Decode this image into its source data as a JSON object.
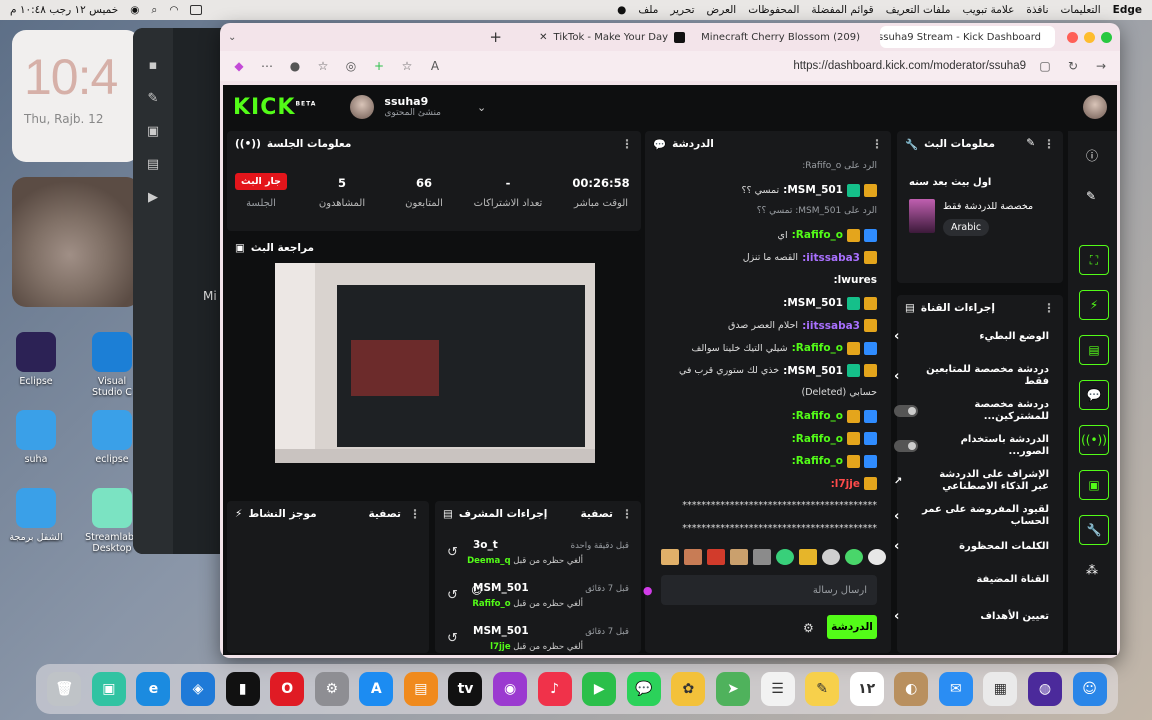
{
  "menubar": {
    "app": "Edge",
    "items": [
      "ملف",
      "تحرير",
      "العرض",
      "المحفوظات",
      "قوائم المفضلة",
      "ملفات التعريف",
      "علامة تبويب",
      "نافذة",
      "التعليمات"
    ],
    "clock": "خميس ١٢ رجب ١٠:٤٨ م"
  },
  "widgets": {
    "time": "10:4",
    "date": "Thu, Rajb. 12"
  },
  "desktop_icons": [
    {
      "label": "Eclipse",
      "color": "#2c2255"
    },
    {
      "label": "Visual Studio C",
      "color": "#1c7fd6"
    },
    {
      "label": "suha",
      "color": "#3aa0e8"
    },
    {
      "label": "eclipse",
      "color": "#3aa0e8"
    },
    {
      "label": "الشفل برمجة",
      "color": "#3aa0e8"
    },
    {
      "label": "Streamlabs Desktop",
      "color": "#7be3c2"
    }
  ],
  "back_window": {
    "side_label": "Mi"
  },
  "browser": {
    "tabs": [
      {
        "title": "ssuha9 Stream - Kick Dashboard",
        "active": true
      },
      {
        "title": "(209) Minecraft Cherry Blossom",
        "active": false
      },
      {
        "title": "TikTok - Make Your Day",
        "active": false
      }
    ],
    "url": "https://dashboard.kick.com/moderator/ssuha9"
  },
  "kick": {
    "logo": "KICK",
    "logo_sup": "BETA",
    "user": {
      "name": "ssuha9",
      "role": "منشئ المحتوى"
    },
    "session": {
      "title": "معلومات الجلسة",
      "live": "جار البث",
      "session_label": "الجلسة",
      "viewers": {
        "value": "5",
        "label": "المشاهدون"
      },
      "followers": {
        "value": "66",
        "label": "المتابعون"
      },
      "subs": {
        "value": "-",
        "label": "تعداد الاشتراكات"
      },
      "uptime": {
        "value": "00:26:58",
        "label": "الوقت مباشر"
      }
    },
    "preview": {
      "title": "مراجعة البث"
    },
    "activity": {
      "title": "موجز النشاط",
      "filter": "تصفية"
    },
    "mod_actions": {
      "title": "إجراءات المشرف",
      "filter": "تصفية",
      "rows": [
        {
          "user": "3o_t",
          "time": "قبل دقيقة واحدة",
          "by_text": "ألغي حظره من قبل",
          "by": "Deema_q"
        },
        {
          "user": "MSM_501",
          "time": "قبل 7 دقائق",
          "by_text": "ألغي حظره من قبل",
          "by": "Rafifo_o"
        },
        {
          "user": "MSM_501",
          "time": "قبل 7 دقائق",
          "by_text": "ألغي حظره من قبل",
          "by": "l7jje"
        }
      ]
    },
    "chat": {
      "title": "الدردشة",
      "messages": [
        {
          "reply": "الرد على Rafifo_o:",
          "name": "",
          "text": "",
          "badges": []
        },
        {
          "name": "MSM_501:",
          "text": "تمسي ؟؟",
          "badges": [
            "gold",
            "green"
          ],
          "color": "#fff"
        },
        {
          "reply": "الرد على MSM_501: تمسي ؟؟",
          "name": "",
          "text": "",
          "badges": []
        },
        {
          "name": "Rafifo_o:",
          "text": "اي",
          "badges": [
            "blue",
            "gold"
          ],
          "color": "#53fc18"
        },
        {
          "name": "iitssaba3:",
          "text": "القصه ما تنزل",
          "badges": [
            "gold"
          ],
          "color": "#a970ff"
        },
        {
          "name": "lwures:",
          "text": "",
          "badges": [],
          "color": "#fff"
        },
        {
          "name": "MSM_501:",
          "text": "",
          "badges": [
            "gold",
            "green"
          ],
          "color": "#fff"
        },
        {
          "name": "iitssaba3:",
          "text": "احلام العصر صدق",
          "badges": [
            "gold"
          ],
          "color": "#a970ff"
        },
        {
          "name": "Rafifo_o:",
          "text": "شيلي التيك خلينا سوالف",
          "badges": [
            "blue",
            "gold"
          ],
          "color": "#53fc18"
        },
        {
          "name": "MSM_501:",
          "text": "خذي لك ستوري قرب في",
          "badges": [
            "gold",
            "green"
          ],
          "color": "#fff"
        },
        {
          "name": "",
          "text": "حسابي (Deleted)",
          "badges": [],
          "color": "#fff"
        },
        {
          "name": "Rafifo_o:",
          "text": "",
          "badges": [
            "blue",
            "gold"
          ],
          "color": "#53fc18"
        },
        {
          "name": "Rafifo_o:",
          "text": "",
          "badges": [
            "blue",
            "gold"
          ],
          "color": "#53fc18"
        },
        {
          "name": "Rafifo_o:",
          "text": "",
          "badges": [
            "blue",
            "gold"
          ],
          "color": "#53fc18"
        },
        {
          "name": "l7jje:",
          "text": "",
          "badges": [
            "gold"
          ],
          "color": "#ff4b4b"
        },
        {
          "name": "",
          "text": "*****************************************",
          "badges": [],
          "color": "#fff"
        },
        {
          "name": "",
          "text": "*****************************************",
          "badges": [],
          "color": "#fff"
        }
      ],
      "placeholder": "ارسال رسالة",
      "send": "الدردشة"
    },
    "stream_info": {
      "title": "معلومات البث",
      "stream_title": "اول بيث بعد سنه",
      "category": "مخصصة للدردشة فقط",
      "tag": "Arabic"
    },
    "channel_actions": {
      "title": "إجراءات القناة",
      "items": [
        {
          "label": "الوضع البطيء",
          "control": "arrow"
        },
        {
          "label": "دردشة مخصصة للمتابعين فقط",
          "control": "arrow"
        },
        {
          "label": "دردشة مخصصة للمشتركين...",
          "control": "toggle"
        },
        {
          "label": "الدردشة باستخدام الصور...",
          "control": "toggle"
        },
        {
          "label": "الإشراف على الدردشة عبر الذكاء الاصطناعي",
          "control": "link"
        },
        {
          "label": "لقيود المفروضة على عمر الحساب",
          "control": "arrow"
        },
        {
          "label": "الكلمات المحظورة",
          "control": "arrow"
        },
        {
          "label": "القناة المضيفة",
          "control": "none"
        },
        {
          "label": "تعيين الأهداف",
          "control": "arrow"
        }
      ]
    }
  },
  "dock": [
    {
      "name": "trash",
      "color": "#bfc3c7",
      "glyph": "🗑"
    },
    {
      "name": "streamlabs",
      "color": "#31c3a2",
      "glyph": "▣"
    },
    {
      "name": "edge",
      "color": "#1b8be0",
      "glyph": "e"
    },
    {
      "name": "defender",
      "color": "#1f7ad8",
      "glyph": "◈"
    },
    {
      "name": "capcut",
      "color": "#111111",
      "glyph": "▮"
    },
    {
      "name": "opera",
      "color": "#e01b24",
      "glyph": "O"
    },
    {
      "name": "settings",
      "color": "#8e8e93",
      "glyph": "⚙"
    },
    {
      "name": "app-store",
      "color": "#1c8cf2",
      "glyph": "A"
    },
    {
      "name": "books",
      "color": "#f08a1d",
      "glyph": "▤"
    },
    {
      "name": "apple-tv",
      "color": "#111111",
      "glyph": "tv"
    },
    {
      "name": "podcasts",
      "color": "#9b3ad0",
      "glyph": "◉"
    },
    {
      "name": "music",
      "color": "#f0324a",
      "glyph": "♪"
    },
    {
      "name": "facetime",
      "color": "#2bbf4a",
      "glyph": "▶"
    },
    {
      "name": "messages",
      "color": "#2bd25a",
      "glyph": "💬"
    },
    {
      "name": "photos",
      "color": "#f3c13a",
      "glyph": "✿"
    },
    {
      "name": "maps",
      "color": "#4fb25c",
      "glyph": "➤"
    },
    {
      "name": "reminders",
      "color": "#f2f2f2",
      "glyph": "☰"
    },
    {
      "name": "notes",
      "color": "#f7d04b",
      "glyph": "✎"
    },
    {
      "name": "calendar",
      "color": "#ffffff",
      "glyph": "١٢"
    },
    {
      "name": "contacts",
      "color": "#b9905f",
      "glyph": "◐"
    },
    {
      "name": "mail",
      "color": "#2a8df3",
      "glyph": "✉"
    },
    {
      "name": "launchpad",
      "color": "#eaeaea",
      "glyph": "▦"
    },
    {
      "name": "siri",
      "color": "#4b2a9b",
      "glyph": "◍"
    },
    {
      "name": "finder",
      "color": "#2a86e8",
      "glyph": "☺"
    }
  ]
}
